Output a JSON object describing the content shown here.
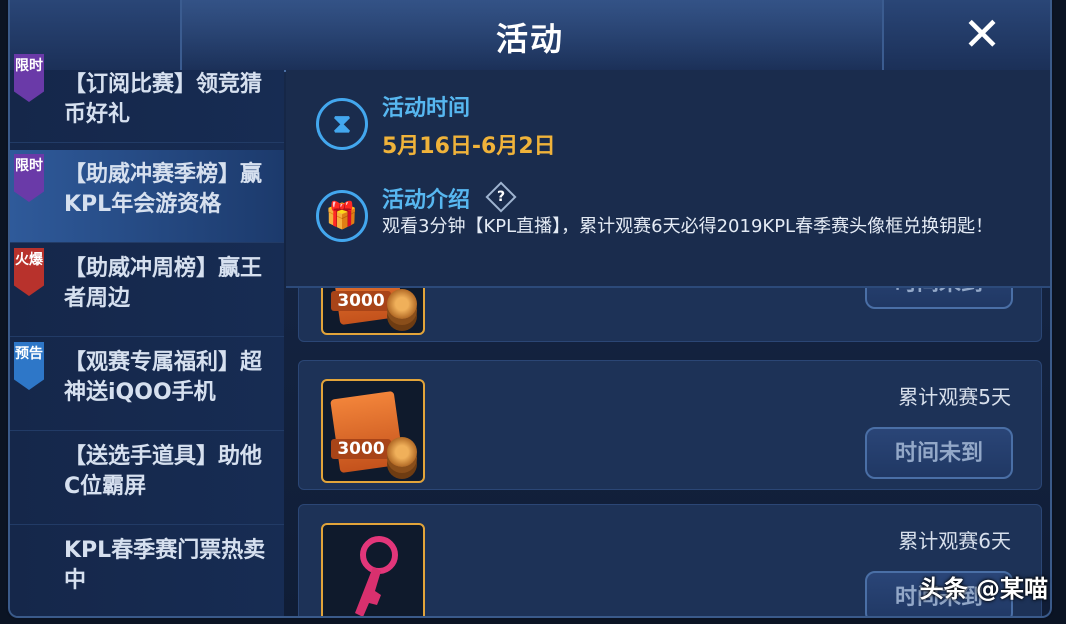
{
  "header": {
    "title": "活动",
    "close_icon": "✕"
  },
  "sidebar": {
    "items": [
      {
        "tag": "限时",
        "tag_color": "purple",
        "label": "【订阅比赛】领竞猜币好礼"
      },
      {
        "tag": "限时",
        "tag_color": "purple",
        "label": "【助威冲赛季榜】赢KPL年会游资格",
        "active": true
      },
      {
        "tag": "火爆",
        "tag_color": "red",
        "label": "【助威冲周榜】赢王者周边"
      },
      {
        "tag": "预告",
        "tag_color": "blue",
        "label": "【观赛专属福利】超神送iQOO手机"
      },
      {
        "tag": "",
        "label": "【送选手道具】助他C位霸屏"
      },
      {
        "tag": "",
        "label": "KPL春季赛门票热卖中"
      }
    ]
  },
  "info": {
    "time_label": "活动时间",
    "time_value": "5月16日-6月2日",
    "intro_label": "活动介绍",
    "help_icon": "?",
    "intro_text": "观看3分钟【KPL直播】，累计观赛6天必得2019KPL春季赛头像框兑换钥匙！"
  },
  "rewards": [
    {
      "item": "3000",
      "requirement": "",
      "button": "时间未到"
    },
    {
      "item": "3000",
      "requirement": "累计观赛5天",
      "button": "时间未到"
    },
    {
      "item": "key",
      "requirement": "累计观赛6天",
      "button": "时间未到"
    }
  ],
  "watermark": "头条 @某喵"
}
